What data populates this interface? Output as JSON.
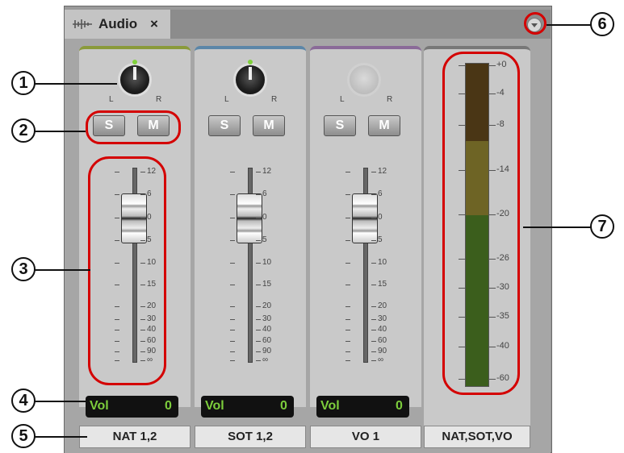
{
  "panel": {
    "tab_title": "Audio",
    "tab_close": "×",
    "tab_icon": "waveform-icon",
    "menu_icon": "panel-menu-icon"
  },
  "tracks": [
    {
      "name": "NAT 1,2",
      "vol_label": "Vol",
      "vol_value": "0",
      "solo": "S",
      "mute": "M",
      "pan_l": "L",
      "pan_r": "R",
      "accent": "#8a9a3a",
      "knob_active": true
    },
    {
      "name": "SOT 1,2",
      "vol_label": "Vol",
      "vol_value": "0",
      "solo": "S",
      "mute": "M",
      "pan_l": "L",
      "pan_r": "R",
      "accent": "#5b86a8",
      "knob_active": true
    },
    {
      "name": "VO 1",
      "vol_label": "Vol",
      "vol_value": "0",
      "solo": "S",
      "mute": "M",
      "pan_l": "L",
      "pan_r": "R",
      "accent": "#8a6a98",
      "knob_active": false
    }
  ],
  "fader_scale": [
    "12",
    "6",
    "0",
    "5",
    "10",
    "15",
    "20",
    "30",
    "40",
    "60",
    "90",
    "∞"
  ],
  "master": {
    "name": "NAT,SOT,VO",
    "meter_scale": [
      "+0",
      "-4",
      "-8",
      "-14",
      "-20",
      "-26",
      "-30",
      "-35",
      "-40",
      "-60"
    ]
  },
  "callouts": [
    "1",
    "2",
    "3",
    "4",
    "5",
    "6",
    "7"
  ],
  "colors": {
    "highlight": "#d40000"
  }
}
